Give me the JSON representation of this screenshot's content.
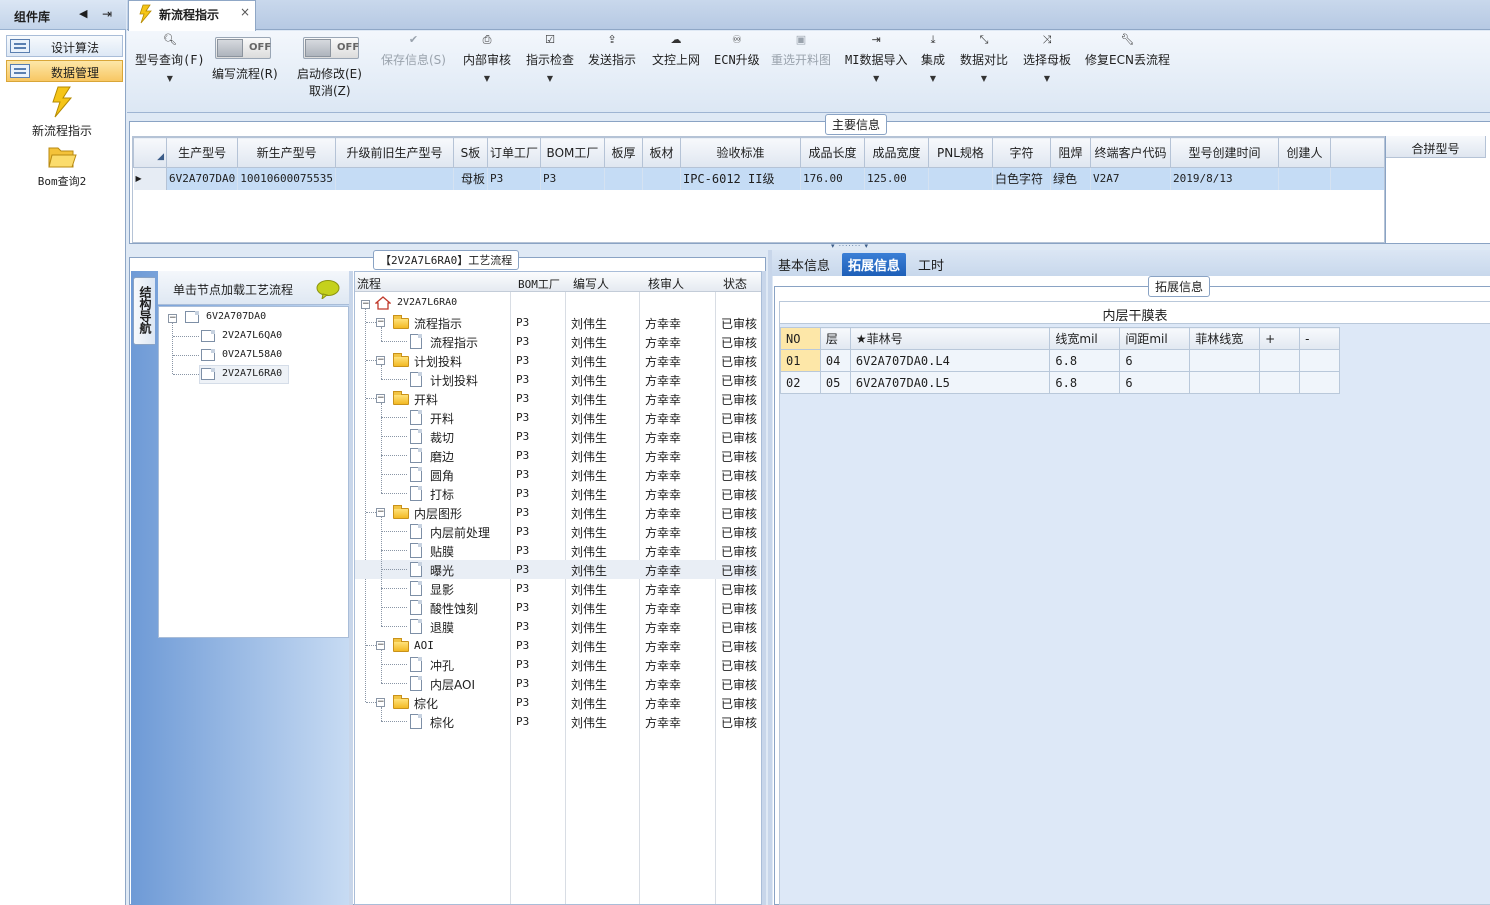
{
  "left_panel": {
    "title": "组件库",
    "items": [
      {
        "label": "设计算法",
        "selected": false
      },
      {
        "label": "数据管理",
        "selected": true
      }
    ],
    "big_items": [
      {
        "label": "新流程指示",
        "icon": "lightning-icon"
      },
      {
        "label": "Bom查询2",
        "icon": "folder-open-icon"
      }
    ]
  },
  "tab": {
    "title": "新流程指示",
    "close": "×"
  },
  "toolbar": {
    "items": [
      {
        "label": "型号查询(F)",
        "icon": "search-icon",
        "dropdown": true
      },
      {
        "label": "编写流程(R)",
        "toggle_state": "OFF"
      },
      {
        "label": "启动修改(E)",
        "label2": "取消(Z)",
        "toggle_state": "OFF"
      },
      {
        "label": "保存信息(S)",
        "icon": "check-icon",
        "disabled": true
      },
      {
        "label": "内部审核",
        "icon": "printer-icon",
        "dropdown": true
      },
      {
        "label": "指示检查",
        "icon": "checkbox-icon",
        "dropdown": true
      },
      {
        "label": "发送指示",
        "icon": "upload-icon"
      },
      {
        "label": "文控上网",
        "icon": "cloud-upload-icon"
      },
      {
        "label": "ECN升级",
        "icon": "binoculars-icon"
      },
      {
        "label": "重选开料图",
        "icon": "image-icon",
        "disabled": true
      },
      {
        "label": "MI数据导入",
        "icon": "sign-in-icon",
        "dropdown": true
      },
      {
        "label": "集成",
        "icon": "download-icon",
        "dropdown": true
      },
      {
        "label": "数据对比",
        "icon": "compress-icon",
        "dropdown": true
      },
      {
        "label": "选择母板",
        "icon": "shuffle-icon",
        "dropdown": true
      },
      {
        "label": "修复ECN丢流程",
        "icon": "wrench-icon"
      }
    ]
  },
  "main_info": {
    "title": "主要信息",
    "columns": [
      "生产型号",
      "新生产型号",
      "升级前旧生产型号",
      "S板",
      "订单工厂",
      "BOM工厂",
      "板厚",
      "板材",
      "验收标准",
      "成品长度",
      "成品宽度",
      "PNL规格",
      "字符",
      "阻焊",
      "终端客户代码",
      "型号创建时间",
      "创建人"
    ],
    "rows": [
      [
        "6V2A707DA0",
        "10010600075535",
        "",
        "母板",
        "P3",
        "P3",
        "",
        "",
        "IPC-6012 II级",
        "176.00",
        "125.00",
        "",
        "白色字符",
        "绿色",
        "V2A7",
        "2019/8/13",
        ""
      ]
    ],
    "merge_header": "合拼型号"
  },
  "process_panel": {
    "title": "【2V2A7L6RA0】工艺流程",
    "side_tab": "结构导航",
    "hint": "单击节点加载工艺流程",
    "structure_tree": {
      "root": "6V2A707DA0",
      "children": [
        "2V2A7L6QA0",
        "0V2A7L58A0",
        "2V2A7L6RA0"
      ]
    },
    "columns": [
      "流程",
      "BOM工厂",
      "编写人",
      "核审人",
      "状态"
    ],
    "root": "2V2A7L6RA0",
    "rows": [
      {
        "name": "流程指示",
        "level": 1,
        "folder": true,
        "factory": "P3",
        "writer": "刘伟生",
        "reviewer": "方幸幸",
        "status": "已审核"
      },
      {
        "name": "流程指示",
        "level": 2,
        "folder": false,
        "factory": "P3",
        "writer": "刘伟生",
        "reviewer": "方幸幸",
        "status": "已审核"
      },
      {
        "name": "计划投料",
        "level": 1,
        "folder": true,
        "factory": "P3",
        "writer": "刘伟生",
        "reviewer": "方幸幸",
        "status": "已审核"
      },
      {
        "name": "计划投料",
        "level": 2,
        "folder": false,
        "factory": "P3",
        "writer": "刘伟生",
        "reviewer": "方幸幸",
        "status": "已审核"
      },
      {
        "name": "开料",
        "level": 1,
        "folder": true,
        "factory": "P3",
        "writer": "刘伟生",
        "reviewer": "方幸幸",
        "status": "已审核"
      },
      {
        "name": "开料",
        "level": 2,
        "folder": false,
        "factory": "P3",
        "writer": "刘伟生",
        "reviewer": "方幸幸",
        "status": "已审核"
      },
      {
        "name": "裁切",
        "level": 2,
        "folder": false,
        "factory": "P3",
        "writer": "刘伟生",
        "reviewer": "方幸幸",
        "status": "已审核"
      },
      {
        "name": "磨边",
        "level": 2,
        "folder": false,
        "factory": "P3",
        "writer": "刘伟生",
        "reviewer": "方幸幸",
        "status": "已审核"
      },
      {
        "name": "圆角",
        "level": 2,
        "folder": false,
        "factory": "P3",
        "writer": "刘伟生",
        "reviewer": "方幸幸",
        "status": "已审核"
      },
      {
        "name": "打标",
        "level": 2,
        "folder": false,
        "factory": "P3",
        "writer": "刘伟生",
        "reviewer": "方幸幸",
        "status": "已审核"
      },
      {
        "name": "内层图形",
        "level": 1,
        "folder": true,
        "factory": "P3",
        "writer": "刘伟生",
        "reviewer": "方幸幸",
        "status": "已审核"
      },
      {
        "name": "内层前处理",
        "level": 2,
        "folder": false,
        "factory": "P3",
        "writer": "刘伟生",
        "reviewer": "方幸幸",
        "status": "已审核"
      },
      {
        "name": "贴膜",
        "level": 2,
        "folder": false,
        "factory": "P3",
        "writer": "刘伟生",
        "reviewer": "方幸幸",
        "status": "已审核"
      },
      {
        "name": "曝光",
        "level": 2,
        "folder": false,
        "factory": "P3",
        "writer": "刘伟生",
        "reviewer": "方幸幸",
        "status": "已审核",
        "highlight": true
      },
      {
        "name": "显影",
        "level": 2,
        "folder": false,
        "factory": "P3",
        "writer": "刘伟生",
        "reviewer": "方幸幸",
        "status": "已审核"
      },
      {
        "name": "酸性蚀刻",
        "level": 2,
        "folder": false,
        "factory": "P3",
        "writer": "刘伟生",
        "reviewer": "方幸幸",
        "status": "已审核"
      },
      {
        "name": "退膜",
        "level": 2,
        "folder": false,
        "factory": "P3",
        "writer": "刘伟生",
        "reviewer": "方幸幸",
        "status": "已审核"
      },
      {
        "name": "AOI",
        "level": 1,
        "folder": true,
        "factory": "P3",
        "writer": "刘伟生",
        "reviewer": "方幸幸",
        "status": "已审核"
      },
      {
        "name": "冲孔",
        "level": 2,
        "folder": false,
        "factory": "P3",
        "writer": "刘伟生",
        "reviewer": "方幸幸",
        "status": "已审核"
      },
      {
        "name": "内层AOI",
        "level": 2,
        "folder": false,
        "factory": "P3",
        "writer": "刘伟生",
        "reviewer": "方幸幸",
        "status": "已审核"
      },
      {
        "name": "棕化",
        "level": 1,
        "folder": true,
        "factory": "P3",
        "writer": "刘伟生",
        "reviewer": "方幸幸",
        "status": "已审核"
      },
      {
        "name": "棕化",
        "level": 2,
        "folder": false,
        "factory": "P3",
        "writer": "刘伟生",
        "reviewer": "方幸幸",
        "status": "已审核"
      }
    ]
  },
  "right_panel": {
    "tabs": [
      {
        "label": "基本信息",
        "active": false
      },
      {
        "label": "拓展信息",
        "active": true
      },
      {
        "label": "工时",
        "active": false
      }
    ],
    "group_title": "拓展信息",
    "table_title": "内层干膜表",
    "columns": [
      "NO",
      "层",
      "★菲林号",
      "线宽mil",
      "间距mil",
      "菲林线宽",
      "+",
      "-"
    ],
    "rows": [
      [
        "01",
        "04",
        "6V2A707DA0.L4",
        "6.8",
        "6",
        "",
        "",
        ""
      ],
      [
        "02",
        "05",
        "6V2A707DA0.L5",
        "6.8",
        "6",
        "",
        "",
        ""
      ]
    ]
  }
}
